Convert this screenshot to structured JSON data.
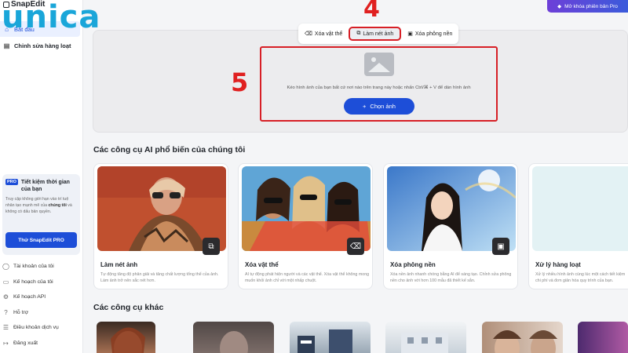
{
  "branding": {
    "app_name": "SnapEdit",
    "watermark": "unica"
  },
  "header": {
    "unlock_label": "Mở khóa phiên bản Pro"
  },
  "sidebar": {
    "items": [
      {
        "label": "Bắt đầu",
        "icon": "home-icon",
        "active": true
      },
      {
        "label": "Chỉnh sửa hàng loạt",
        "icon": "layers-icon",
        "active": false
      }
    ],
    "promo": {
      "badge": "PRO",
      "title": "Tiết kiệm thời gian của bạn",
      "text_1": "Truy cập không giới hạn vào trí tuệ nhân tạo mạnh mẽ của ",
      "text_bold": "chúng tôi",
      "text_2": " và không có dấu bản quyền.",
      "button": "Thử SnapEdit PRO"
    },
    "bottom_items": [
      {
        "label": "Tài khoản của tôi",
        "icon": "user-icon"
      },
      {
        "label": "Kế hoạch của tôi",
        "icon": "plan-icon"
      },
      {
        "label": "Kế hoạch API",
        "icon": "api-icon"
      },
      {
        "label": "Hỗ trợ",
        "icon": "help-icon"
      },
      {
        "label": "Điều khoản dịch vụ",
        "icon": "document-icon"
      },
      {
        "label": "Đăng xuất",
        "icon": "logout-icon"
      }
    ]
  },
  "upload": {
    "tabs": [
      {
        "label": "Xóa vật thể",
        "icon": "eraser-icon",
        "active": false
      },
      {
        "label": "Làm nét ảnh",
        "icon": "enhance-icon",
        "active": true
      },
      {
        "label": "Xóa phông nền",
        "icon": "background-icon",
        "active": false
      }
    ],
    "drop_text": "Kéo hình ảnh của bạn bất cứ nơi nào trên trang này hoặc nhấn Ctrl/⌘ + V để dán hình ảnh",
    "choose_button": "Chọn ảnh"
  },
  "annotations": {
    "step_4": "4",
    "step_5": "5",
    "color": "#e02020"
  },
  "sections": {
    "popular_title": "Các công cụ AI phổ biến của chúng tôi",
    "other_title": "Các công cụ khác"
  },
  "cards": [
    {
      "title": "Làm nét ảnh",
      "desc": "Tự động tăng độ phân giải và tăng chất lượng tổng thể của ảnh. Làm ảnh trở nên sắc nét hơn.",
      "badge_icon": "enhance-icon"
    },
    {
      "title": "Xóa vật thể",
      "desc": "AI tự động phát hiện người và các vật thể. Xóa vật thể không mong muốn khỏi ảnh chỉ với một nhấp chuột.",
      "badge_icon": "eraser-icon"
    },
    {
      "title": "Xóa phông nền",
      "desc": "Xóa nền ảnh nhanh chóng bằng AI để sáng tạo. Chỉnh sửa phông nền cho ảnh với hơn 100 mẫu đã thiết kế sẵn.",
      "badge_icon": "background-icon"
    },
    {
      "title": "Xử lý hàng loạt",
      "desc": "Xử lý nhiều hình ảnh cùng lúc một cách tiết kiệm chi phí và đơn giản hóa quy trình của bạn.",
      "badge_icon": ""
    }
  ],
  "colors": {
    "primary": "#1d4ed8",
    "highlight": "#d71f26",
    "watermark": "#1aa6d9"
  }
}
